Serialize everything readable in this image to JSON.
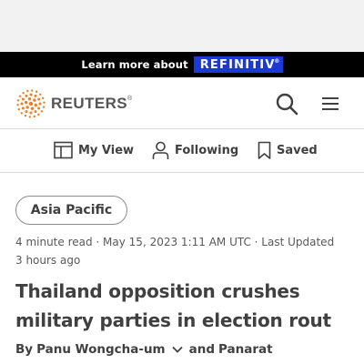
{
  "promo": {
    "text": "Learn more about",
    "brand": "REFINITIV",
    "brand_mark": "®",
    "brand_color": "#1b39d6"
  },
  "header": {
    "logo_text": "REUTERS",
    "logo_mark": "®",
    "logo_color": "#f27c21",
    "search_icon": "search-icon",
    "menu_icon": "hamburger-menu-icon"
  },
  "subnav": {
    "items": [
      {
        "label": "My View",
        "icon": "my-view-icon"
      },
      {
        "label": "Following",
        "icon": "person-icon"
      },
      {
        "label": "Saved",
        "icon": "bookmark-icon"
      }
    ]
  },
  "article": {
    "tag": "Asia Pacific",
    "meta": "4 minute read · May 15, 2023 1:11 AM UTC · Last Updated 3 hours ago",
    "headline": "Thailand opposition crushes military parties in election rout",
    "byline_prefix": "By",
    "author1": "Panu Wongcha-um",
    "byline_and": "and",
    "author2": "Panarat"
  }
}
